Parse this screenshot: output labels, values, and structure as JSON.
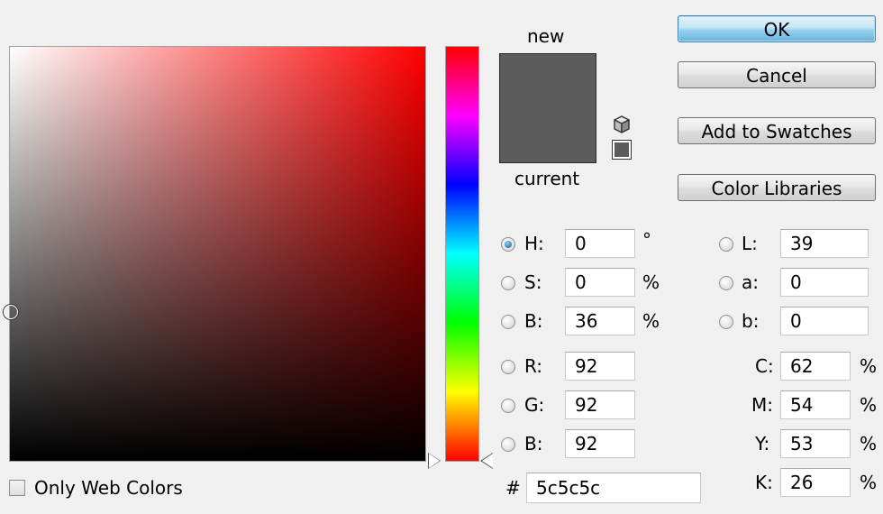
{
  "colors": {
    "new_color": "#5c5c5c",
    "current_color": "#5c5c5c",
    "hue_base": "#ff0000"
  },
  "preview": {
    "new_label": "new",
    "current_label": "current"
  },
  "buttons": {
    "ok": "OK",
    "cancel": "Cancel",
    "add_to_swatches": "Add to Swatches",
    "color_libraries": "Color Libraries"
  },
  "hsb": {
    "h": {
      "label": "H:",
      "value": "0",
      "unit": "°",
      "selected": true
    },
    "s": {
      "label": "S:",
      "value": "0",
      "unit": "%",
      "selected": false
    },
    "b": {
      "label": "B:",
      "value": "36",
      "unit": "%",
      "selected": false
    }
  },
  "rgb": {
    "r": {
      "label": "R:",
      "value": "92"
    },
    "g": {
      "label": "G:",
      "value": "92"
    },
    "b": {
      "label": "B:",
      "value": "92"
    }
  },
  "lab": {
    "l": {
      "label": "L:",
      "value": "39"
    },
    "a": {
      "label": "a:",
      "value": "0"
    },
    "b": {
      "label": "b:",
      "value": "0"
    }
  },
  "cmyk": {
    "c": {
      "label": "C:",
      "value": "62",
      "unit": "%"
    },
    "m": {
      "label": "M:",
      "value": "54",
      "unit": "%"
    },
    "y": {
      "label": "Y:",
      "value": "53",
      "unit": "%"
    },
    "k": {
      "label": "K:",
      "value": "26",
      "unit": "%"
    }
  },
  "hex": {
    "label": "#",
    "value": "5c5c5c"
  },
  "web_colors": {
    "label": "Only Web Colors",
    "checked": false
  },
  "icons": {
    "gamut_warning": "cube-icon",
    "web_safe": "swatch-icon"
  }
}
